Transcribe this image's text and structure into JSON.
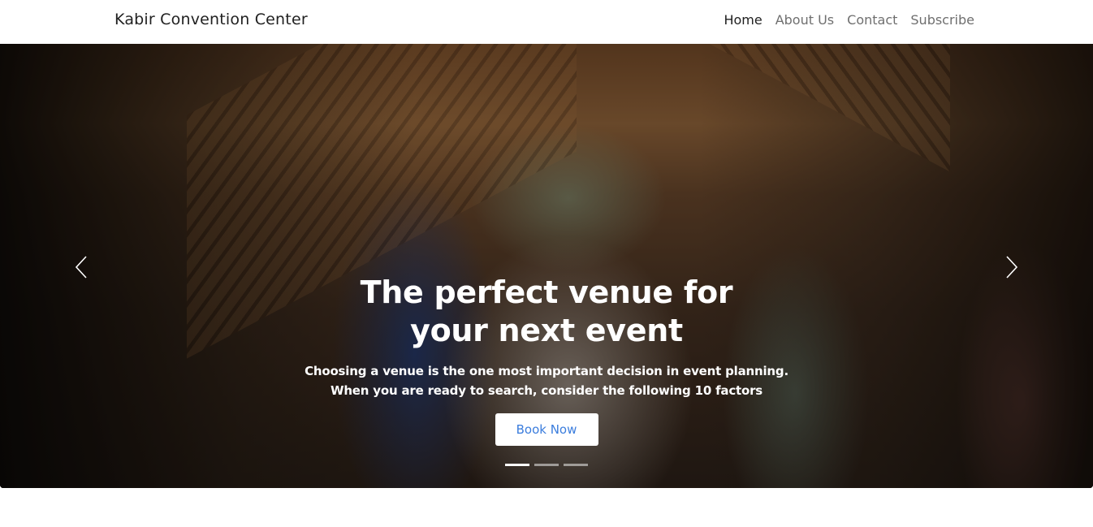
{
  "navbar": {
    "brand": "Kabir Convention Center",
    "links": [
      {
        "label": "Home",
        "active": true
      },
      {
        "label": "About Us",
        "active": false
      },
      {
        "label": "Contact",
        "active": false
      },
      {
        "label": "Subscribe",
        "active": false
      }
    ]
  },
  "hero": {
    "headline": "The perfect venue for your next event",
    "subtext": "Choosing a venue is the one most important decision in event planning. When you are ready to search, consider the following 10 factors",
    "cta_label": "Book Now",
    "prev_icon": "chevron-left-icon",
    "next_icon": "chevron-right-icon",
    "slide_count": 3,
    "active_slide": 1
  },
  "colors": {
    "cta_text": "#3b7ddd",
    "brand_text": "#212121",
    "nav_inactive": "#6f6f6f"
  }
}
